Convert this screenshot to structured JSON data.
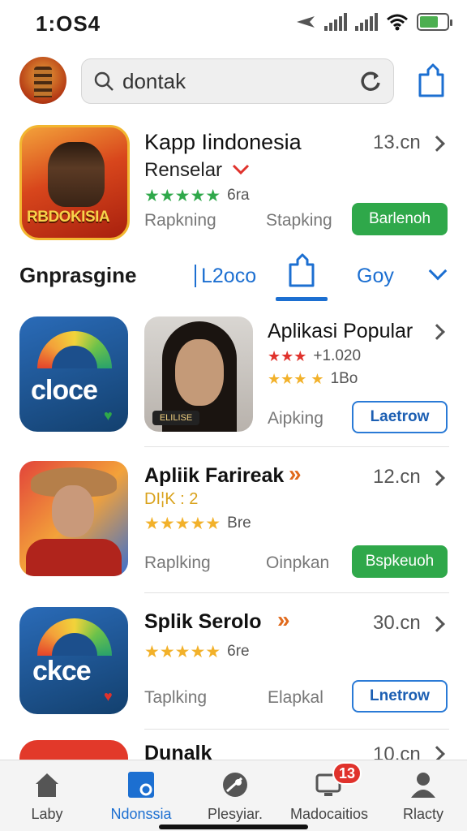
{
  "status_bar": {
    "time": "1:OS4",
    "battery_level": 0.7
  },
  "search": {
    "query": "dontak"
  },
  "featured": {
    "title": "Kapp Iindonesia",
    "subtitle": "Renselar",
    "rating_count": "6ra",
    "rating_stars": 5,
    "size": "13.cn",
    "meta_left": "Rapkning",
    "meta_right": "Stapking",
    "action_label": "Barlenoh",
    "icon_text": "RBDOKISIA"
  },
  "section": {
    "title": "Gnprasgine",
    "tabs": [
      "L2oco",
      "Goy"
    ]
  },
  "apps": [
    {
      "title": "Aplikasi Popular",
      "rating_line_1": "+1.020",
      "rating_line_2": "1Bo",
      "meta_left": "Aipking",
      "action_label": "Laetrow",
      "left_icon_text": "cloce",
      "photo_caption": "ELILISE"
    },
    {
      "title": "Apliik Farireak",
      "subtitle": "DI¦K : 2",
      "rating_count": "Bre",
      "size": "12.cn",
      "meta_left": "Raplking",
      "meta_right": "Oinpkan",
      "action_label": "Bspkeuoh"
    },
    {
      "title": "Splik Serolo",
      "rating_count": "6re",
      "size": "30.cn",
      "meta_left": "Taplking",
      "meta_right": "Elapkal",
      "action_label": "Lnetrow",
      "icon_text": "ckce"
    },
    {
      "title": "Dunalk",
      "size": "10.cn"
    }
  ],
  "bottom_nav": [
    {
      "label": "Laby",
      "icon": "home-icon",
      "active": false
    },
    {
      "label": "Ndonssia",
      "icon": "search-square-icon",
      "active": true
    },
    {
      "label": "Plesyiar.",
      "icon": "satellite-icon",
      "active": false
    },
    {
      "label": "Madocaitios",
      "icon": "device-icon",
      "active": false,
      "badge": "13"
    },
    {
      "label": "Rlacty",
      "icon": "person-icon",
      "active": false
    }
  ],
  "colors": {
    "accent": "#1c6fd1",
    "green": "#2fa84a",
    "star": "#f2b12a",
    "badge": "#e0322c"
  }
}
